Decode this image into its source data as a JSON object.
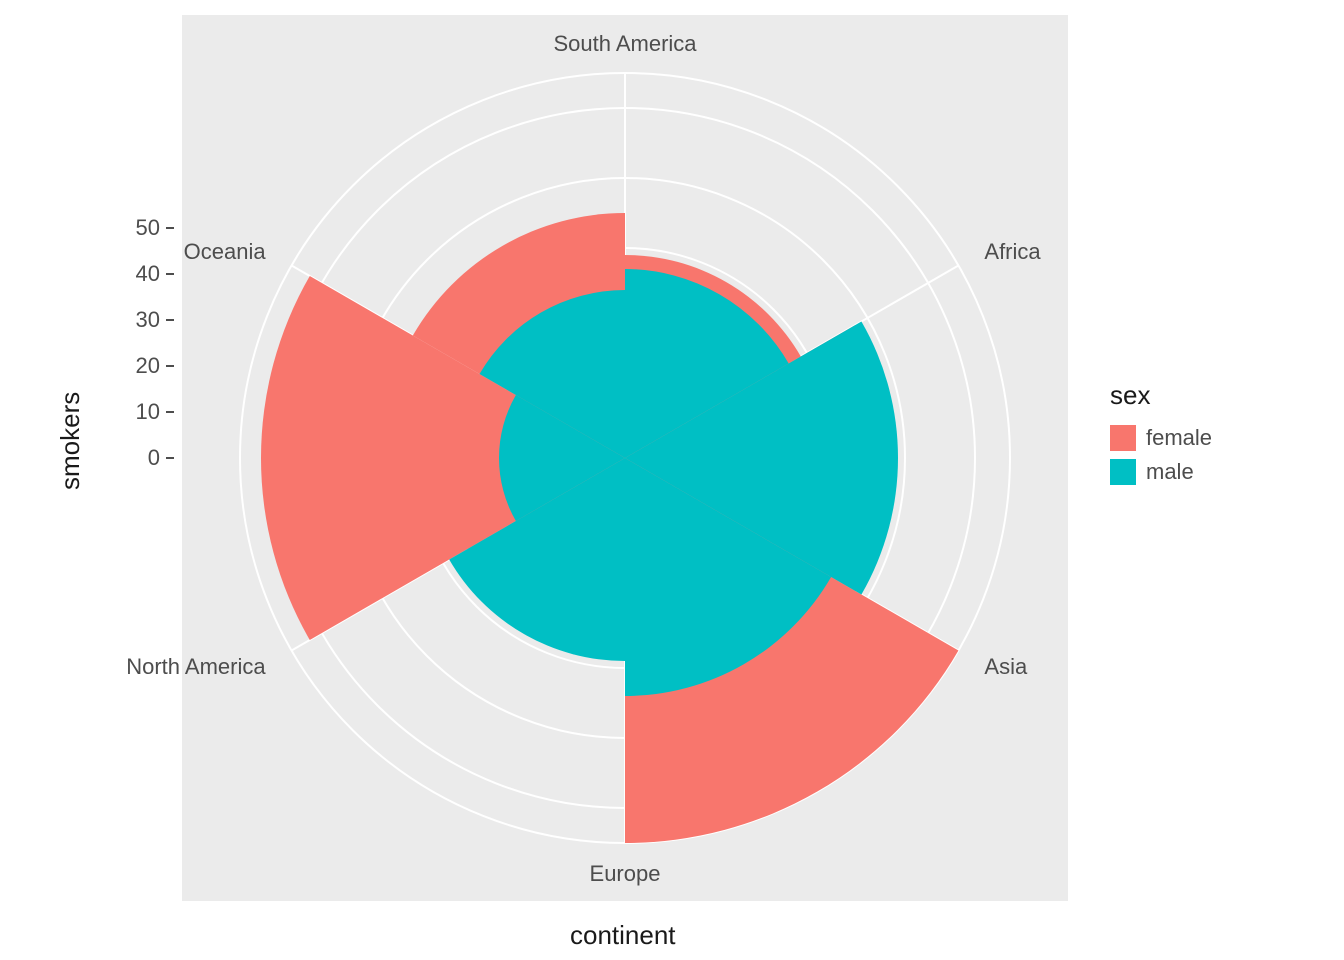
{
  "chart_data": {
    "type": "bar",
    "polar": true,
    "categories": [
      "Africa",
      "Asia",
      "Europe",
      "North America",
      "Oceania",
      "South America"
    ],
    "series": [
      {
        "name": "female",
        "values": [
          29,
          38,
          55,
          26,
          52,
          35
        ],
        "color": "#F8766D"
      },
      {
        "name": "male",
        "values": [
          27,
          39,
          34,
          29,
          18,
          24
        ],
        "color": "#00BFC4"
      }
    ],
    "xlabel": "continent",
    "ylabel": "smokers",
    "ylim": [
      0,
      55
    ],
    "yticks": [
      0,
      10,
      20,
      30,
      40,
      50
    ],
    "legend_title": "sex",
    "legend_position": "right",
    "grid": true
  },
  "labels": {
    "ylabel": "smokers",
    "xlabel": "continent",
    "legend_title": "sex",
    "legend_items": [
      "female",
      "male"
    ],
    "categories": [
      "Africa",
      "Asia",
      "Europe",
      "North America",
      "Oceania",
      "South America"
    ],
    "yticks": [
      "0",
      "10",
      "20",
      "30",
      "40",
      "50"
    ]
  },
  "colors": {
    "panel_bg": "#ebebeb",
    "grid": "#ffffff",
    "female": "#F8766D",
    "male": "#00BFC4"
  }
}
